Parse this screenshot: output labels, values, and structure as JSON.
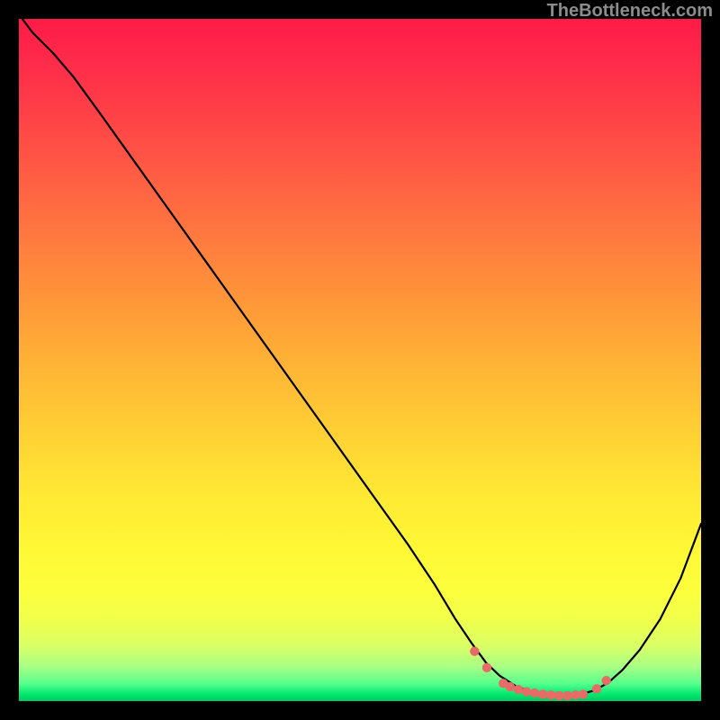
{
  "watermark": "TheBottleneck.com",
  "chart_data": {
    "type": "line",
    "title": "",
    "xlabel": "",
    "ylabel": "",
    "xlim": [
      0,
      100
    ],
    "ylim": [
      0,
      100
    ],
    "grid": false,
    "legend": false,
    "series": [
      {
        "name": "curve-black",
        "stroke": "#000000",
        "stroke_width": 2,
        "x": [
          0.5,
          2,
          5,
          8,
          12,
          17,
          22,
          27,
          32,
          37,
          42,
          47,
          52,
          57,
          61,
          64,
          66.5,
          68.5,
          70.5,
          73,
          76,
          79,
          82,
          84.5,
          86.5,
          88.5,
          91,
          94,
          97,
          100
        ],
        "y": [
          100,
          98,
          95,
          91.5,
          86,
          79,
          72,
          65,
          58,
          51,
          44,
          37,
          30,
          23,
          17,
          12,
          8.3,
          5.6,
          3.7,
          2.1,
          1.1,
          0.7,
          0.9,
          1.6,
          2.8,
          4.6,
          7.5,
          12,
          18,
          26
        ]
      },
      {
        "name": "dots-salmon",
        "stroke": "#e76b67",
        "marker": true,
        "x": [
          66.8,
          68.6,
          71.0,
          72.0,
          73.2,
          74.4,
          75.6,
          76.8,
          78.0,
          79.2,
          80.4,
          81.6,
          82.7,
          84.7,
          86.1
        ],
        "y": [
          7.3,
          4.9,
          2.6,
          2.1,
          1.7,
          1.4,
          1.2,
          1.0,
          0.9,
          0.8,
          0.8,
          0.9,
          1.0,
          1.8,
          3.0
        ]
      }
    ],
    "background_gradient": {
      "top": "#ff1b47",
      "mid_upper": "#ffa537",
      "mid_lower": "#fff835",
      "bottom": "#00c95e"
    }
  }
}
